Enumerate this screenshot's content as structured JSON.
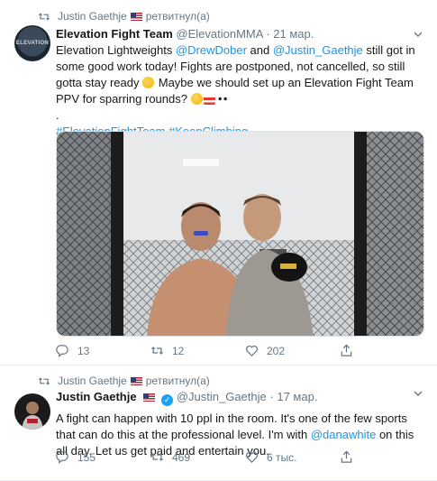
{
  "tweets": [
    {
      "retweet_label": "Justin Gaethje",
      "retweet_suffix": "ретвитнул(а)",
      "author_name": "Elevation Fight Team",
      "author_handle": "@ElevationMMA",
      "date": "21 мар.",
      "avatar_text": "ELEVATION",
      "text": {
        "p1": "Elevation Lightweights ",
        "mention1": "@DrewDober",
        "p2": " and ",
        "mention2": "@Justin_Gaethje",
        "p3": " still got in some good work today! Fights are postponed, not cancelled, so still gotta stay ready ",
        "p4": " Maybe we should set up an Elevation Fight Team PPV for sparring rounds? ",
        "dot": ".",
        "hashtag1": "#ElevationFightTeam",
        "hashtag2": "#KeepClimbing"
      },
      "stats": {
        "replies": "13",
        "retweets": "12",
        "likes": "202"
      }
    },
    {
      "retweet_label": "Justin Gaethje",
      "retweet_suffix": "ретвитнул(а)",
      "author_name": "Justin Gaethje",
      "author_handle": "@Justin_Gaethje",
      "date": "17 мар.",
      "text": {
        "p1": "A fight can happen with 10 ppl in the room. It's one of the few sports that can do this at the professional level. I'm with ",
        "mention1": "@danawhite",
        "p2": " on this all day. Let us get paid and entertain you."
      },
      "stats": {
        "replies": "155",
        "retweets": "469",
        "likes": "6 тыс."
      }
    }
  ],
  "colors": {
    "accent": "#1da1f2",
    "link": "#1b95e0",
    "muted": "#657786",
    "text": "#14171a"
  },
  "icons": [
    "retweet-icon",
    "flag-us-icon",
    "verified-badge-icon",
    "caret-down-icon",
    "reply-icon",
    "heart-icon",
    "share-icon",
    "flexed-biceps-emoji",
    "popcorn-emoji",
    "eyes-emoji",
    "thinking-emoji"
  ]
}
